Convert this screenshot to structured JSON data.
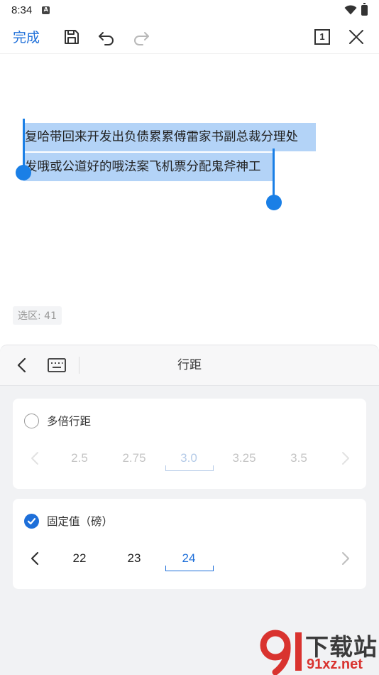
{
  "status_bar": {
    "time": "8:34",
    "notif_letter": "A"
  },
  "toolbar": {
    "done_label": "完成",
    "page_indicator": "1"
  },
  "editor": {
    "line1": "复哈带回来开发出负债累累傅雷家书副总裁分理处",
    "line2": "发哦或公道好的哦法案飞机票分配鬼斧神工",
    "selection_count": "选区: 41"
  },
  "panel": {
    "title": "行距",
    "multiple": {
      "label": "多倍行距",
      "checked": false,
      "values": [
        "2.5",
        "2.75",
        "3.0",
        "3.25",
        "3.5"
      ],
      "selected": "3.0"
    },
    "fixed": {
      "label": "固定值（磅）",
      "checked": true,
      "values": [
        "22",
        "23",
        "24"
      ],
      "selected": "24"
    }
  },
  "watermark": {
    "line1": "下载站",
    "line2": "91xz.net"
  },
  "colors": {
    "accent": "#1e6fd9",
    "selection": "#b3d3f7",
    "handle": "#1a7fe6",
    "watermark_red": "#d9332f"
  }
}
